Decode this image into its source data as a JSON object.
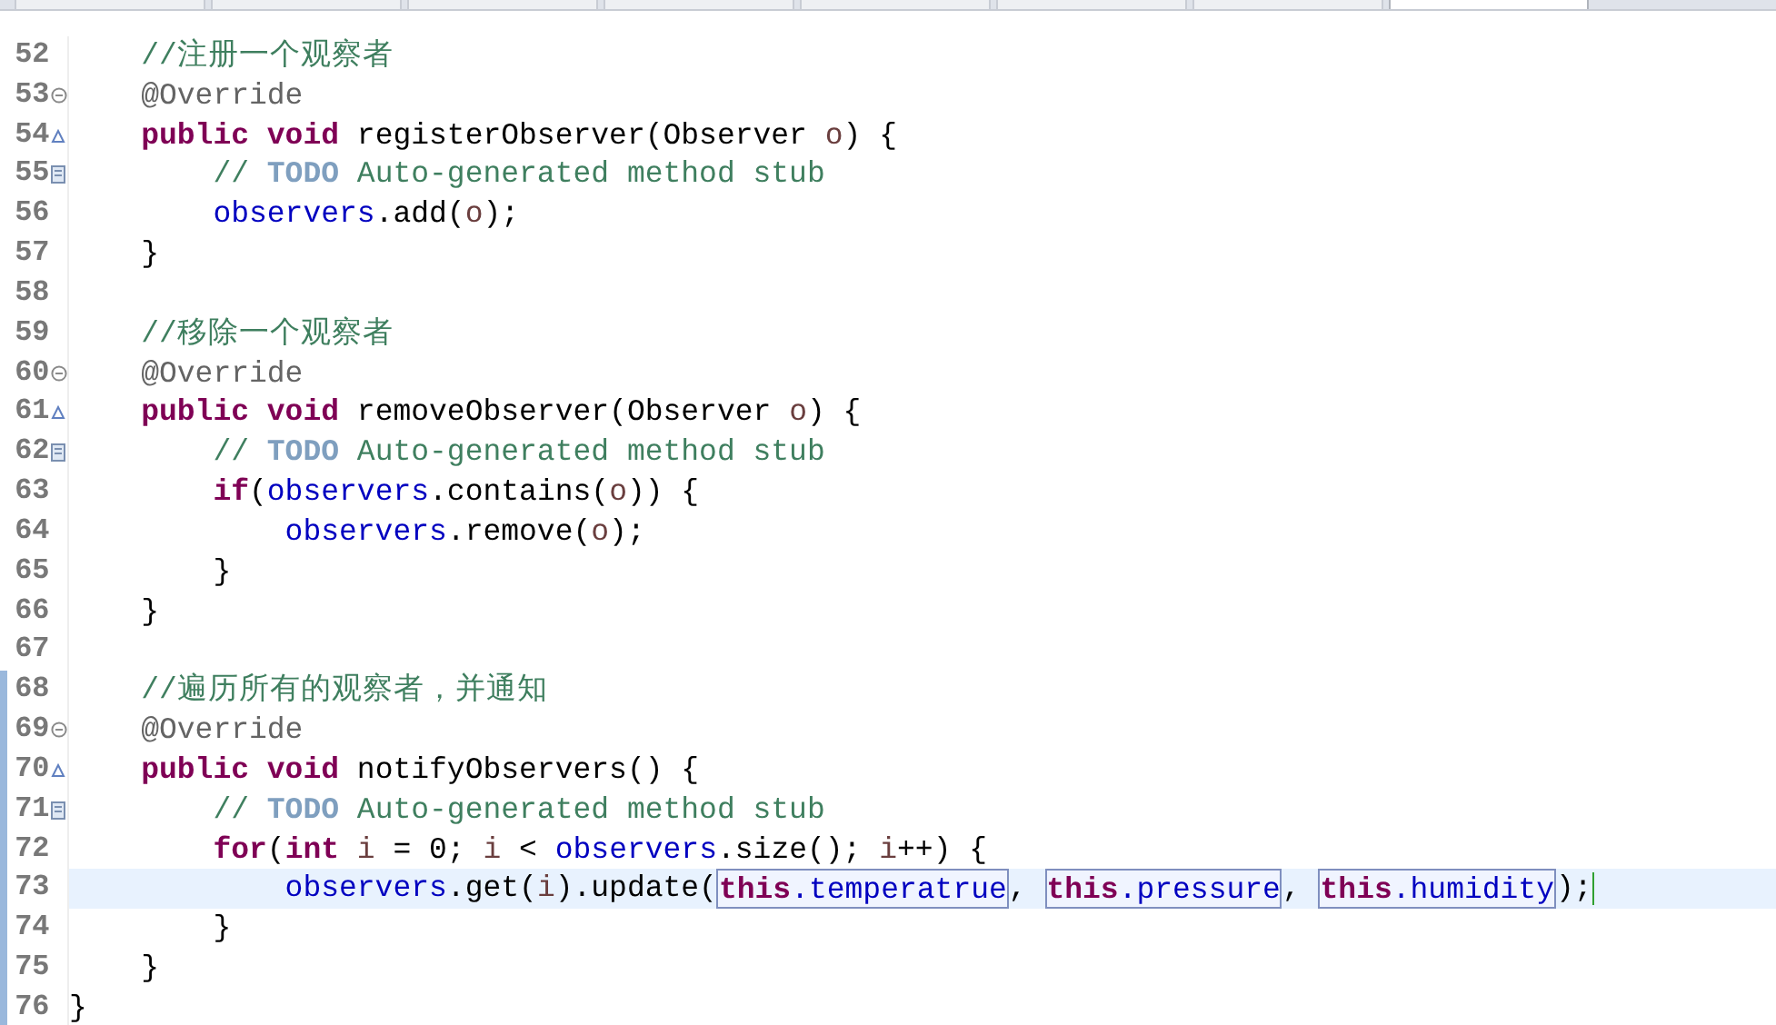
{
  "tabs": [
    {
      "selected": false
    },
    {
      "selected": false
    },
    {
      "selected": false
    },
    {
      "selected": false
    },
    {
      "selected": false
    },
    {
      "selected": false
    },
    {
      "selected": false
    },
    {
      "selected": true
    }
  ],
  "lines": [
    {
      "n": "52",
      "kind": "member",
      "tokens": [
        {
          "t": "//注册一个观察者",
          "kind": "comment"
        }
      ]
    },
    {
      "n": "53",
      "marker": {
        "kind": "fold"
      },
      "kind": "member",
      "tokens": [
        {
          "t": "@Override",
          "kind": "annotation"
        }
      ]
    },
    {
      "n": "54",
      "marker": {
        "kind": "override"
      },
      "kind": "member",
      "tokens": [
        {
          "t": "public void",
          "kind": "kw"
        },
        {
          "t": " registerObserver(Observer ",
          "kind": "plain"
        },
        {
          "t": "o",
          "kind": "local"
        },
        {
          "t": ") {",
          "kind": "plain"
        }
      ]
    },
    {
      "n": "55",
      "marker": {
        "kind": "task"
      },
      "kind": "body",
      "tokens": [
        {
          "t": "// ",
          "kind": "comment"
        },
        {
          "t": "TODO",
          "kind": "todo"
        },
        {
          "t": " Auto-generated method stub",
          "kind": "comment"
        }
      ]
    },
    {
      "n": "56",
      "kind": "body",
      "tokens": [
        {
          "t": "observers",
          "kind": "field"
        },
        {
          "t": ".add(",
          "kind": "plain"
        },
        {
          "t": "o",
          "kind": "local"
        },
        {
          "t": ");",
          "kind": "plain"
        }
      ]
    },
    {
      "n": "57",
      "kind": "member",
      "tokens": [
        {
          "t": "}",
          "kind": "plain"
        }
      ]
    },
    {
      "n": "58"
    },
    {
      "n": "59",
      "kind": "member",
      "tokens": [
        {
          "t": "//移除一个观察者",
          "kind": "comment"
        }
      ]
    },
    {
      "n": "60",
      "marker": {
        "kind": "fold"
      },
      "kind": "member",
      "tokens": [
        {
          "t": "@Override",
          "kind": "annotation"
        }
      ]
    },
    {
      "n": "61",
      "marker": {
        "kind": "override"
      },
      "kind": "member",
      "tokens": [
        {
          "t": "public void",
          "kind": "kw"
        },
        {
          "t": " removeObserver(Observer ",
          "kind": "plain"
        },
        {
          "t": "o",
          "kind": "local"
        },
        {
          "t": ") {",
          "kind": "plain"
        }
      ]
    },
    {
      "n": "62",
      "marker": {
        "kind": "task"
      },
      "kind": "body",
      "tokens": [
        {
          "t": "// ",
          "kind": "comment"
        },
        {
          "t": "TODO",
          "kind": "todo"
        },
        {
          "t": " Auto-generated method stub",
          "kind": "comment"
        }
      ]
    },
    {
      "n": "63",
      "kind": "body",
      "tokens": [
        {
          "t": "if",
          "kind": "kw"
        },
        {
          "t": "(",
          "kind": "plain"
        },
        {
          "t": "observers",
          "kind": "field"
        },
        {
          "t": ".contains(",
          "kind": "plain"
        },
        {
          "t": "o",
          "kind": "local"
        },
        {
          "t": ")) {",
          "kind": "plain"
        }
      ]
    },
    {
      "n": "64",
      "kind": "nested",
      "tokens": [
        {
          "t": "observers",
          "kind": "field"
        },
        {
          "t": ".remove(",
          "kind": "plain"
        },
        {
          "t": "o",
          "kind": "local"
        },
        {
          "t": ");",
          "kind": "plain"
        }
      ]
    },
    {
      "n": "65",
      "kind": "body",
      "tokens": [
        {
          "t": "}",
          "kind": "plain"
        }
      ]
    },
    {
      "n": "66",
      "kind": "member",
      "tokens": [
        {
          "t": "}",
          "kind": "plain"
        }
      ]
    },
    {
      "n": "67"
    },
    {
      "n": "68",
      "changed": true,
      "kind": "member",
      "tokens": [
        {
          "t": "//遍历所有的观察者，并通知",
          "kind": "comment"
        }
      ]
    },
    {
      "n": "69",
      "changed": true,
      "marker": {
        "kind": "fold"
      },
      "kind": "member",
      "tokens": [
        {
          "t": "@Override",
          "kind": "annotation"
        }
      ]
    },
    {
      "n": "70",
      "changed": true,
      "marker": {
        "kind": "override"
      },
      "kind": "member",
      "tokens": [
        {
          "t": "public void",
          "kind": "kw"
        },
        {
          "t": " notifyObservers() {",
          "kind": "plain"
        }
      ]
    },
    {
      "n": "71",
      "changed": true,
      "marker": {
        "kind": "task"
      },
      "kind": "body",
      "tokens": [
        {
          "t": "// ",
          "kind": "comment"
        },
        {
          "t": "TODO",
          "kind": "todo"
        },
        {
          "t": " Auto-generated method stub",
          "kind": "comment"
        }
      ]
    },
    {
      "n": "72",
      "changed": true,
      "kind": "body",
      "tokens": [
        {
          "t": "for",
          "kind": "kw"
        },
        {
          "t": "(",
          "kind": "plain"
        },
        {
          "t": "int ",
          "kind": "kw"
        },
        {
          "t": "i",
          "kind": "local"
        },
        {
          "t": " = 0; ",
          "kind": "plain"
        },
        {
          "t": "i",
          "kind": "local"
        },
        {
          "t": " < ",
          "kind": "plain"
        },
        {
          "t": "observers",
          "kind": "field"
        },
        {
          "t": ".size(); ",
          "kind": "plain"
        },
        {
          "t": "i",
          "kind": "local"
        },
        {
          "t": "++) {",
          "kind": "plain"
        }
      ]
    },
    {
      "n": "73",
      "changed": true,
      "current": true,
      "caret": true,
      "kind": "nested",
      "tokens": [
        {
          "t": "observers",
          "kind": "field"
        },
        {
          "t": ".get(",
          "kind": "plain"
        },
        {
          "t": "i",
          "kind": "local"
        },
        {
          "t": ").update(",
          "kind": "plain"
        },
        {
          "t": "this.temperatrue",
          "kind": "boxed"
        },
        {
          "t": ", ",
          "kind": "plain"
        },
        {
          "t": "this.pressure",
          "kind": "boxed"
        },
        {
          "t": ", ",
          "kind": "plain"
        },
        {
          "t": "this.humidity",
          "kind": "boxed"
        },
        {
          "t": ");",
          "kind": "plain"
        }
      ]
    },
    {
      "n": "74",
      "changed": true,
      "kind": "body",
      "tokens": [
        {
          "t": "}",
          "kind": "plain"
        }
      ]
    },
    {
      "n": "75",
      "changed": true,
      "kind": "member",
      "tokens": [
        {
          "t": "}",
          "kind": "plain"
        }
      ]
    },
    {
      "n": "76",
      "changed": true,
      "kind": "top",
      "tokens": [
        {
          "t": "}",
          "kind": "plain"
        }
      ]
    }
  ]
}
